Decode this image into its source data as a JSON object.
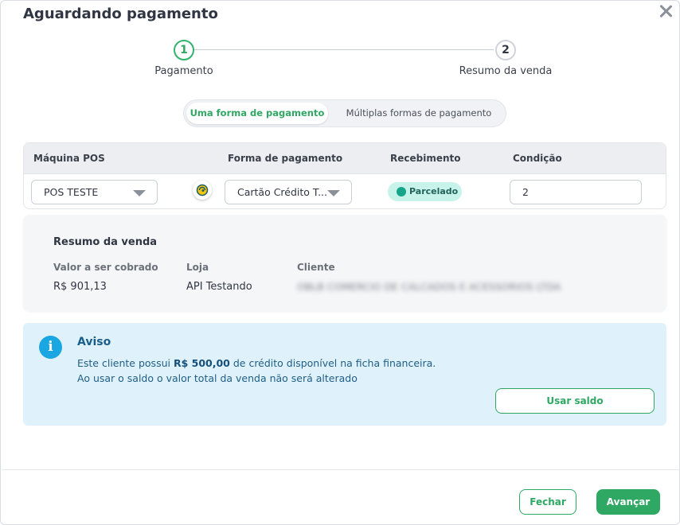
{
  "modal": {
    "title": "Aguardando pagamento"
  },
  "stepper": {
    "steps": [
      {
        "number": "1",
        "label": "Pagamento"
      },
      {
        "number": "2",
        "label": "Resumo da venda"
      }
    ]
  },
  "payment_mode": {
    "options": [
      "Uma forma de pagamento",
      "Múltiplas formas de pagamento"
    ],
    "selected": "Uma forma de pagamento"
  },
  "table": {
    "headers": [
      "Máquina POS",
      "Forma de pagamento",
      "Recebimento",
      "Condição"
    ],
    "row": {
      "pos": "POS TESTE",
      "payment_method": "Cartão Crédito T...",
      "receipt": "Parcelado",
      "condition": "2"
    }
  },
  "summary": {
    "heading": "Resumo da venda",
    "labels": [
      "Valor a ser cobrado",
      "Loja",
      "Cliente"
    ],
    "amount": "R$ 901,13",
    "store": "API Testando",
    "client": "OBLB COMERCIO DE CALCADOS E ACESSORIOS LTDA"
  },
  "notice": {
    "title": "Aviso",
    "line1_prefix": "Este cliente possui ",
    "line1_amount": "R$ 500,00",
    "line1_suffix": " de crédito disponível na ficha financeira.",
    "line2": "Ao usar o saldo o valor total da venda não será alterado",
    "button": "Usar saldo"
  },
  "footer": {
    "close_label": "Fechar",
    "next_label": "Avançar"
  },
  "colors": {
    "accent": "#2ea862",
    "info": "#1aa6e0",
    "info_bg": "#dff1fb",
    "badge_bg": "#c8f3ea"
  },
  "icons": [
    "close-icon",
    "chevron-down-icon",
    "card-brand-icon",
    "info-icon",
    "status-dot-icon"
  ]
}
